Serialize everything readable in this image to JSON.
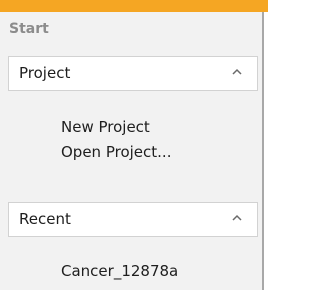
{
  "panel": {
    "title": "Start"
  },
  "sections": [
    {
      "label": "Project",
      "items": [
        "New Project",
        "Open Project..."
      ]
    },
    {
      "label": "Recent",
      "items": [
        "Cancer_12878a"
      ]
    }
  ],
  "colors": {
    "accent": "#f5a623",
    "panel_bg": "#f2f2f2",
    "header_bg": "#ffffff",
    "border": "#d2d2d2"
  },
  "icons": {
    "collapse": "chevron-up-icon"
  }
}
